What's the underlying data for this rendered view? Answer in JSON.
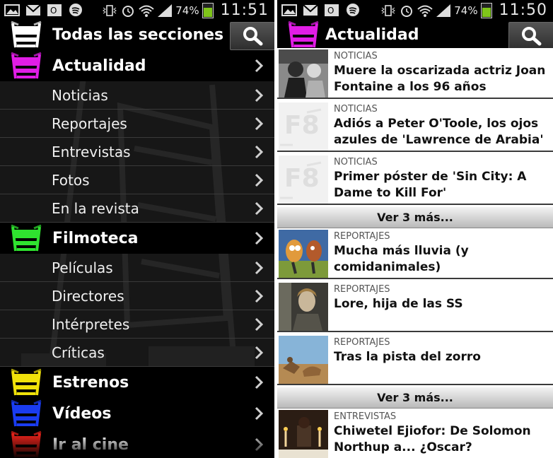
{
  "left_screen": {
    "status_bar": {
      "battery": "74%",
      "time": "11:51",
      "battery_level": 0.74
    },
    "search_icon": "search-icon",
    "menu": [
      {
        "type": "section",
        "label": "Todas las secciones",
        "icon_color": "#ffffff"
      },
      {
        "type": "section",
        "label": "Actualidad",
        "icon_color": "#e11de6"
      },
      {
        "type": "sub",
        "label": "Noticias"
      },
      {
        "type": "sub",
        "label": "Reportajes"
      },
      {
        "type": "sub",
        "label": "Entrevistas"
      },
      {
        "type": "sub",
        "label": "Fotos"
      },
      {
        "type": "sub",
        "label": "En la revista"
      },
      {
        "type": "section",
        "label": "Filmoteca",
        "icon_color": "#2fe22f"
      },
      {
        "type": "sub",
        "label": "Películas"
      },
      {
        "type": "sub",
        "label": "Directores"
      },
      {
        "type": "sub",
        "label": "Intérpretes"
      },
      {
        "type": "sub",
        "label": "Críticas"
      },
      {
        "type": "section",
        "label": "Estrenos",
        "icon_color": "#f0e20a"
      },
      {
        "type": "section",
        "label": "Vídeos",
        "icon_color": "#1a3cf0"
      },
      {
        "type": "section",
        "label": "Ir al cine",
        "icon_color": "#e8231b"
      }
    ]
  },
  "right_screen": {
    "status_bar": {
      "battery": "74%",
      "time": "11:50",
      "battery_level": 0.74
    },
    "header": {
      "title": "Actualidad",
      "icon_color": "#e11de6"
    },
    "items": [
      {
        "kind": "article",
        "category": "NOTICIAS",
        "headline": "Muere la oscarizada actriz Joan Fontaine a los 96 años",
        "thumb": "photo"
      },
      {
        "kind": "article",
        "category": "NOTICIAS",
        "headline": "Adiós a Peter O'Toole, los ojos azules de 'Lawrence de Arabia'",
        "thumb": "placeholder"
      },
      {
        "kind": "article",
        "category": "NOTICIAS",
        "headline": "Primer póster de 'Sin City: A Dame to Kill For'",
        "thumb": "placeholder"
      },
      {
        "kind": "more",
        "label": "Ver 3 más..."
      },
      {
        "kind": "article",
        "category": "REPORTAJES",
        "headline": "Mucha más lluvia (y comidanimales)",
        "thumb": "cartoon"
      },
      {
        "kind": "article",
        "category": "REPORTAJES",
        "headline": "Lore, hija de las SS",
        "thumb": "portrait"
      },
      {
        "kind": "article",
        "category": "REPORTAJES",
        "headline": "Tras la pista del zorro",
        "thumb": "sky"
      },
      {
        "kind": "more",
        "label": "Ver 3 más..."
      },
      {
        "kind": "article",
        "category": "ENTREVISTAS",
        "headline": "Chiwetel Ejiofor: De Solomon Northup a... ¿Oscar?",
        "thumb": "candles"
      }
    ]
  }
}
